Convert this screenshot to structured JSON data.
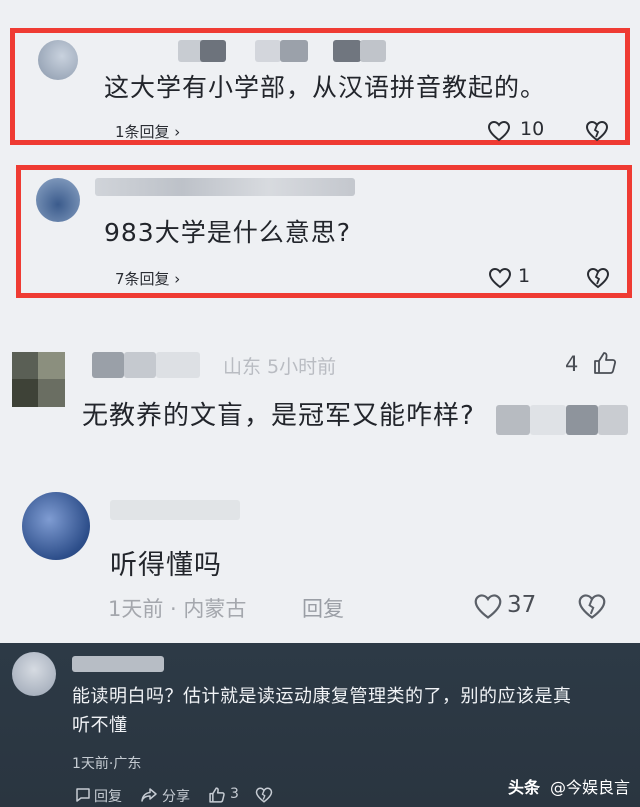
{
  "comments": [
    {
      "text": "这大学有小学部，从汉语拼音教起的。",
      "reply_label": "1条回复 ›",
      "likes": "10"
    },
    {
      "text": "983大学是什么意思?",
      "reply_label": "7条回复 ›",
      "likes": "1"
    },
    {
      "location_time": "山东  5小时前",
      "likes": "4",
      "text": "无教养的文盲，是冠军又能咋样?"
    },
    {
      "text": "听得懂吗",
      "meta": "1天前 · 内蒙古",
      "reply_label": "回复",
      "likes": "37"
    }
  ],
  "dark_comment": {
    "text_line1": "能读明白吗？估计就是读运动康复管理类的了，别的应该是真",
    "text_line2": "听不懂",
    "meta": "1天前·广东",
    "reply_label": "回复",
    "share_label": "分享",
    "likes": "3"
  },
  "watermark": {
    "brand": "头条",
    "author": "@今娱良言"
  },
  "colors": {
    "highlight_border": "#ef3b33",
    "background": "#eef0f3",
    "dark_panel": "#2d3a46"
  }
}
